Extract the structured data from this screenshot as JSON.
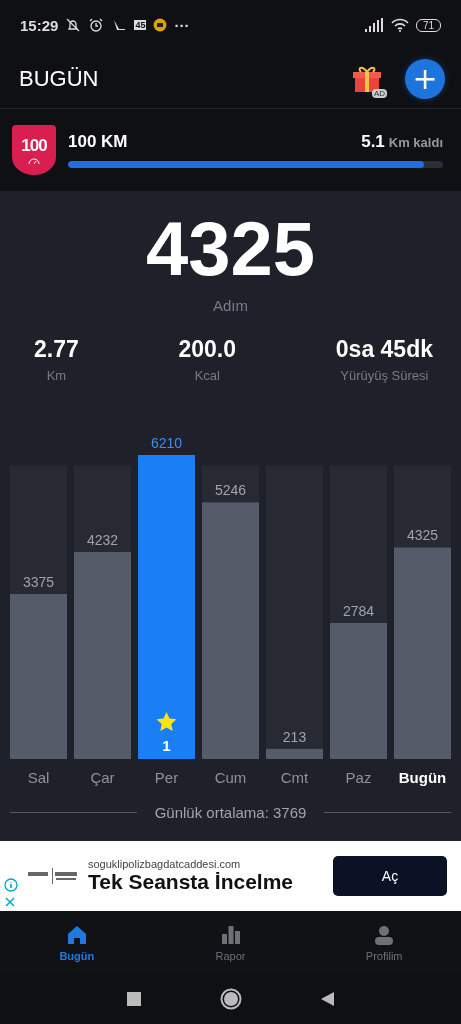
{
  "status_bar": {
    "time": "15:29",
    "notification_badge": "45",
    "more": "···",
    "battery": "71"
  },
  "header": {
    "title": "BUGÜN",
    "gift_badge": "AD",
    "add_button": "+"
  },
  "goal": {
    "badge": "100",
    "title": "100 KM",
    "remaining_value": "5.1",
    "remaining_label": "Km kaldı",
    "level": 0.949
  },
  "summary": {
    "steps": "4325",
    "steps_label": "Adım",
    "stats": [
      {
        "value": "2.77",
        "label": "Km"
      },
      {
        "value": "200.0",
        "label": "Kcal"
      },
      {
        "value": "0sa 45dk",
        "label": "Yürüyüş Süresi"
      }
    ]
  },
  "chart": {
    "chart_data": {
      "type": "bar",
      "categories": [
        "Sal",
        "Çar",
        "Per",
        "Cum",
        "Cmt",
        "Paz",
        "Bugün"
      ],
      "series": [
        {
          "color": "#555b68",
          "values": [
            3375,
            4232,
            null,
            5246,
            213,
            2784,
            4325
          ],
          "value_labels": [
            "3375",
            "4232",
            null,
            "5246",
            "213",
            "2784",
            "4325"
          ]
        },
        {
          "color": "#1a7ef5",
          "values": [
            null,
            null,
            6210,
            null,
            null,
            null,
            null
          ],
          "value_labels": [
            null,
            null,
            "6210",
            null,
            null,
            null,
            null
          ]
        },
        {
          "color": "#272a33",
          "values": [
            2625,
            1768,
            null,
            754,
            5787,
            3216,
            1675
          ]
        }
      ],
      "stacked": true,
      "ylim": [
        0,
        6210
      ]
    },
    "bold_label": [
      false,
      false,
      false,
      false,
      false,
      false,
      true
    ],
    "star_count": "1",
    "average": "Günlük ortalama: 3769"
  },
  "ad": {
    "domain": "soguklipolizbagdatcaddesi.com",
    "headline": "Tek Seansta İncelme",
    "button": "Aç"
  },
  "bottom_nav": [
    {
      "label": "Bugün",
      "selected": true
    },
    {
      "label": "Rapor",
      "selected": false
    },
    {
      "label": "Profilim",
      "selected": false
    }
  ]
}
